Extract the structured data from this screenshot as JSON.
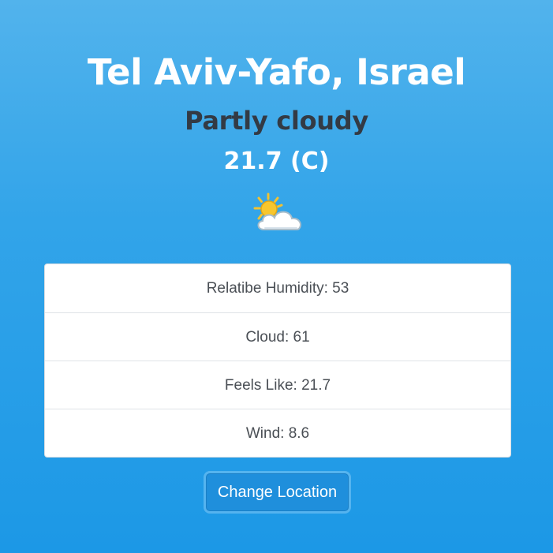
{
  "weather": {
    "location": "Tel Aviv-Yafo, Israel",
    "condition": "Partly cloudy",
    "temperature": "21.7 (C)",
    "icon": "partly-cloudy-icon"
  },
  "details": [
    {
      "text": "Relatibe Humidity: 53"
    },
    {
      "text": "Cloud: 61"
    },
    {
      "text": "Feels Like: 21.7"
    },
    {
      "text": "Wind: 8.6"
    }
  ],
  "actions": {
    "change_location_label": "Change Location"
  },
  "colors": {
    "background_top": "#52b3ec",
    "background_bottom": "#1c98e6",
    "button": "#1f8fdc",
    "condition_text": "#333a44"
  }
}
